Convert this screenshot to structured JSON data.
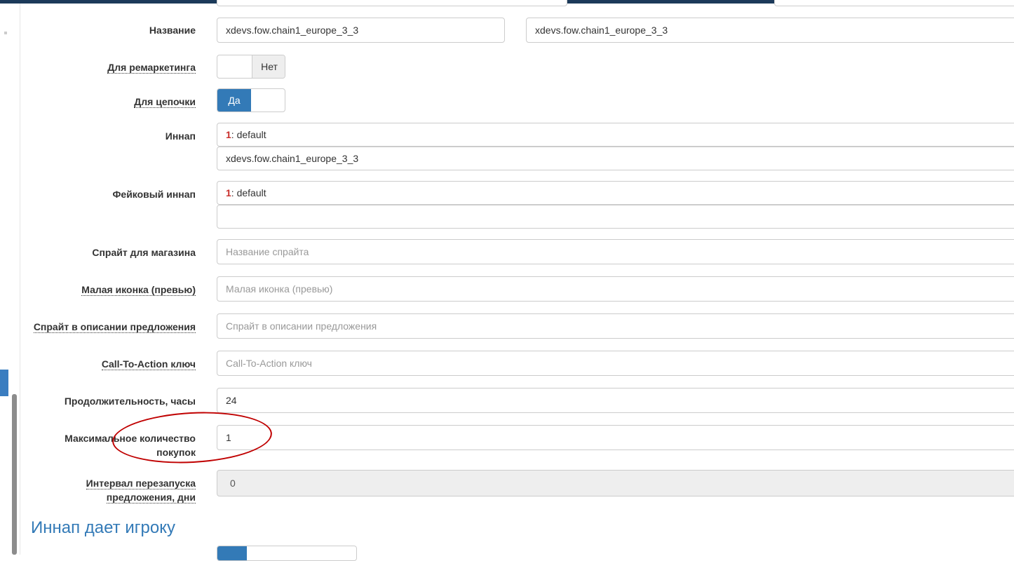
{
  "fields": {
    "name": {
      "label": "Название",
      "value_1": "xdevs.fow.chain1_europe_3_3",
      "value_2": "xdevs.fow.chain1_europe_3_3"
    },
    "remarketing": {
      "label": "Для ремаркетинга",
      "toggle_label": "Нет"
    },
    "chain": {
      "label": "Для цепочки",
      "toggle_label": "Да"
    },
    "innap": {
      "label": "Иннап",
      "selected_index": "1",
      "selected_text": ": default",
      "value": "xdevs.fow.chain1_europe_3_3"
    },
    "fake_innap": {
      "label": "Фейковый иннап",
      "selected_index": "1",
      "selected_text": ": default",
      "value": ""
    },
    "shop_sprite": {
      "label": "Спрайт для магазина",
      "placeholder": "Название спрайта"
    },
    "small_icon": {
      "label": "Малая иконка (превью)",
      "placeholder": "Малая иконка (превью)"
    },
    "offer_sprite": {
      "label": "Спрайт в описании предложения",
      "placeholder": "Спрайт в описании предложения"
    },
    "cta_key": {
      "label": "Call-To-Action ключ",
      "placeholder": "Call-To-Action ключ"
    },
    "duration": {
      "label": "Продолжительность, часы",
      "value": "24"
    },
    "max_purchases": {
      "label_line1": "Максимальное количество",
      "label_line2": "покупок",
      "value": "1"
    },
    "restart_interval": {
      "label_line1": "Интервал перезапуска",
      "label_line2": "предложения, дни",
      "value": "0"
    }
  },
  "section": {
    "title": "Иннап дает игроку"
  },
  "colors": {
    "primary": "#337ab7",
    "annotation": "#c00000",
    "index_red": "#c9302c"
  }
}
